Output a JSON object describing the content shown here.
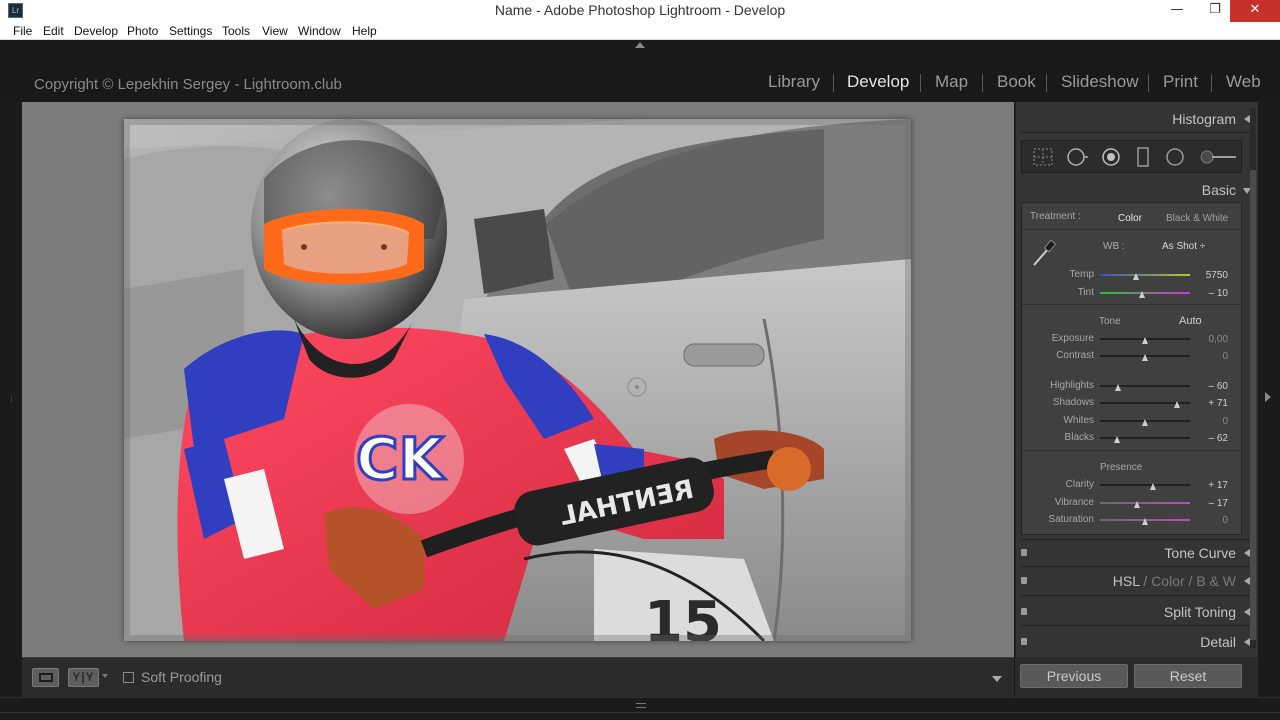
{
  "window": {
    "app_icon": "Lr",
    "title": "Name - Adobe Photoshop Lightroom - Develop",
    "minimize_glyph": "—",
    "maximize_glyph": "❐",
    "close_glyph": "✕"
  },
  "menu": [
    "File",
    "Edit",
    "Develop",
    "Photo",
    "Settings",
    "Tools",
    "View",
    "Window",
    "Help"
  ],
  "identity_plate": "Copyright © Lepekhin Sergey - Lightroom.club",
  "modules": [
    "Library",
    "Develop",
    "Map",
    "Book",
    "Slideshow",
    "Print",
    "Web"
  ],
  "active_module": "Develop",
  "toolbar": {
    "loupe_icon": "loupe-view-icon",
    "compare_label": "Y|Y",
    "soft_proofing_label": "Soft Proofing",
    "soft_proofing_checked": false
  },
  "photo": {
    "jersey_text": "CK",
    "bar_text": "RENTHAL",
    "plate_number": "15"
  },
  "right_panel": {
    "histogram": "Histogram",
    "tool_icons": [
      "crop-overlay-icon",
      "spot-removal-icon",
      "red-eye-icon",
      "graduated-filter-icon",
      "radial-filter-icon",
      "adjustment-brush-icon"
    ],
    "basic": {
      "header": "Basic",
      "treatment_label": "Treatment :",
      "treatment_color": "Color",
      "treatment_bw": "Black & White",
      "wb_label": "WB :",
      "wb_value": "As Shot ÷",
      "temp_label": "Temp",
      "temp_value": "5750",
      "temp_pos": 0.4,
      "tint_label": "Tint",
      "tint_value": "– 10",
      "tint_pos": 0.47,
      "tone_label": "Tone",
      "auto_label": "Auto",
      "sliders": [
        {
          "label": "Exposure",
          "value": "0,00",
          "pos": 0.5,
          "zero": true
        },
        {
          "label": "Contrast",
          "value": "0",
          "pos": 0.5,
          "zero": true
        },
        {
          "label": "Highlights",
          "value": "– 60",
          "pos": 0.2,
          "zero": false
        },
        {
          "label": "Shadows",
          "value": "+ 71",
          "pos": 0.855,
          "zero": false
        },
        {
          "label": "Whites",
          "value": "0",
          "pos": 0.5,
          "zero": true
        },
        {
          "label": "Blacks",
          "value": "– 62",
          "pos": 0.19,
          "zero": false
        }
      ],
      "presence_label": "Presence",
      "presence_sliders": [
        {
          "label": "Clarity",
          "value": "+ 17",
          "pos": 0.585,
          "zero": false
        },
        {
          "label": "Vibrance",
          "value": "– 17",
          "pos": 0.415,
          "zero": false
        },
        {
          "label": "Saturation",
          "value": "0",
          "pos": 0.5,
          "zero": true
        }
      ]
    },
    "tone_curve": "Tone Curve",
    "hsl": "HSL",
    "hsl_sep1": "/",
    "hsl_color": "Color",
    "hsl_sep2": "/",
    "hsl_bw": "B & W",
    "split_toning": "Split Toning",
    "detail": "Detail"
  },
  "buttons": {
    "previous": "Previous",
    "reset": "Reset"
  },
  "colors": {
    "panel_bg": "#343434",
    "canvas_bg": "#7c7c7c",
    "active_module": "#e6e6e6",
    "jersey_red": "#e8334a",
    "jersey_blue": "#2f3fbf",
    "goggle_orange": "#ff6a1a"
  }
}
